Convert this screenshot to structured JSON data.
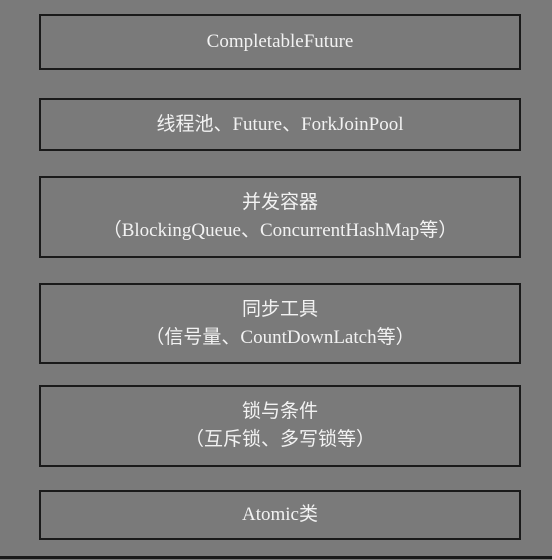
{
  "diagram": {
    "layers": [
      {
        "line1": "CompletableFuture",
        "line2": ""
      },
      {
        "line1": "线程池、Future、ForkJoinPool",
        "line2": ""
      },
      {
        "line1": "并发容器",
        "line2": "（BlockingQueue、ConcurrentHashMap等）"
      },
      {
        "line1": "同步工具",
        "line2": "（信号量、CountDownLatch等）"
      },
      {
        "line1": "锁与条件",
        "line2": "（互斥锁、多写锁等）"
      },
      {
        "line1": "Atomic类",
        "line2": ""
      }
    ]
  }
}
